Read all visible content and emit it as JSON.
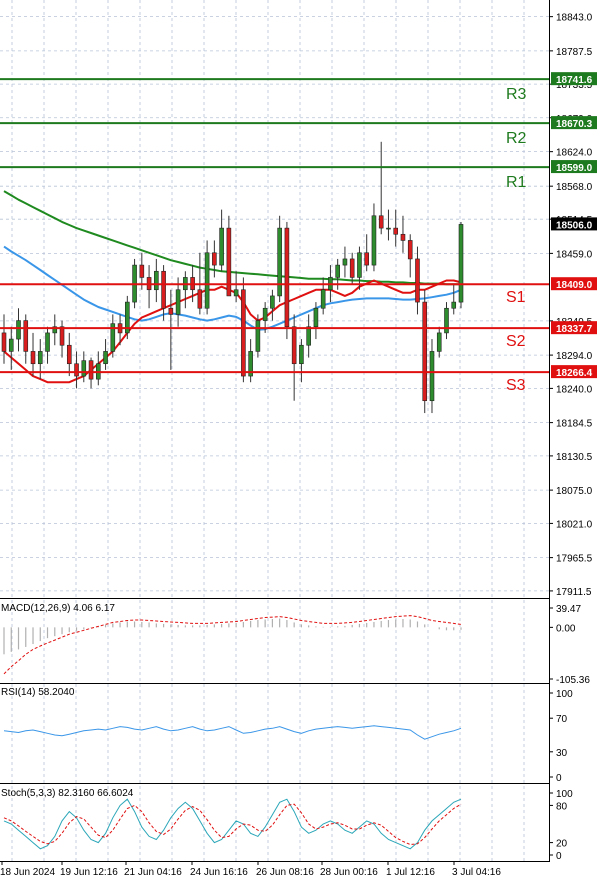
{
  "chart_data": [
    {
      "type": "candlestick",
      "panel": "main",
      "ylim": [
        17900,
        18870
      ],
      "y_ticks": [
        "18843.0",
        "18787.5",
        "18733.5",
        "18679.0",
        "18624.0",
        "18568.0",
        "18514.5",
        "18459.0",
        "18349.5",
        "18294.0",
        "18240.0",
        "18184.5",
        "18130.5",
        "18075.0",
        "18021.0",
        "17965.5",
        "17911.5"
      ],
      "x_labels": [
        "18 Jun 2024",
        "19 Jun 12:16",
        "21 Jun 04:16",
        "24 Jun 16:16",
        "26 Jun 08:16",
        "28 Jun 00:16",
        "1 Jul 12:16",
        "3 Jul 04:16"
      ],
      "current_price": "18506.0",
      "colors": {
        "bull": "#2e8b2e",
        "bear": "#d81e1e",
        "resistance": "#1e7a1e",
        "support": "#e01010",
        "ma_fast": "#e01010",
        "ma_mid": "#3a96e8",
        "ma_slow": "#1f8a1f",
        "grid": "#b8c4d8"
      },
      "levels": [
        {
          "name": "R3",
          "value": 18741.6,
          "label": "18741.6",
          "kind": "resistance"
        },
        {
          "name": "R2",
          "value": 18670.3,
          "label": "18670.3",
          "kind": "resistance"
        },
        {
          "name": "R1",
          "value": 18599.0,
          "label": "18599.0",
          "kind": "resistance"
        },
        {
          "name": "S1",
          "value": 18409.0,
          "label": "18409.0",
          "kind": "support"
        },
        {
          "name": "S2",
          "value": 18337.7,
          "label": "18337.7",
          "kind": "support"
        },
        {
          "name": "S3",
          "value": 18266.4,
          "label": "18266.4",
          "kind": "support"
        }
      ],
      "candles": [
        [
          18330,
          18360,
          18280,
          18300
        ],
        [
          18300,
          18340,
          18270,
          18320
        ],
        [
          18320,
          18370,
          18300,
          18350
        ],
        [
          18350,
          18360,
          18280,
          18300
        ],
        [
          18300,
          18330,
          18260,
          18280
        ],
        [
          18280,
          18320,
          18255,
          18300
        ],
        [
          18300,
          18340,
          18280,
          18330
        ],
        [
          18330,
          18360,
          18310,
          18340
        ],
        [
          18340,
          18350,
          18290,
          18310
        ],
        [
          18310,
          18330,
          18260,
          18280
        ],
        [
          18280,
          18300,
          18240,
          18260
        ],
        [
          18260,
          18300,
          18250,
          18285
        ],
        [
          18285,
          18290,
          18240,
          18255
        ],
        [
          18255,
          18300,
          18245,
          18280
        ],
        [
          18280,
          18320,
          18270,
          18300
        ],
        [
          18300,
          18360,
          18290,
          18345
        ],
        [
          18345,
          18360,
          18310,
          18330
        ],
        [
          18330,
          18390,
          18320,
          18380
        ],
        [
          18380,
          18450,
          18370,
          18440
        ],
        [
          18440,
          18460,
          18400,
          18420
        ],
        [
          18420,
          18440,
          18370,
          18400
        ],
        [
          18400,
          18450,
          18380,
          18430
        ],
        [
          18430,
          18440,
          18350,
          18370
        ],
        [
          18370,
          18400,
          18270,
          18360
        ],
        [
          18360,
          18420,
          18340,
          18400
        ],
        [
          18400,
          18430,
          18370,
          18420
        ],
        [
          18420,
          18440,
          18380,
          18400
        ],
        [
          18400,
          18460,
          18360,
          18370
        ],
        [
          18370,
          18480,
          18360,
          18460
        ],
        [
          18460,
          18480,
          18420,
          18440
        ],
        [
          18440,
          18530,
          18430,
          18500
        ],
        [
          18500,
          18520,
          18460,
          18390
        ],
        [
          18390,
          18430,
          18380,
          18400
        ],
        [
          18400,
          18420,
          18250,
          18260
        ],
        [
          18260,
          18320,
          18250,
          18300
        ],
        [
          18300,
          18360,
          18290,
          18350
        ],
        [
          18350,
          18380,
          18330,
          18370
        ],
        [
          18370,
          18400,
          18350,
          18390
        ],
        [
          18390,
          18520,
          18380,
          18500
        ],
        [
          18500,
          18510,
          18320,
          18340
        ],
        [
          18340,
          18360,
          18220,
          18280
        ],
        [
          18280,
          18320,
          18250,
          18310
        ],
        [
          18310,
          18360,
          18290,
          18340
        ],
        [
          18340,
          18380,
          18320,
          18370
        ],
        [
          18370,
          18420,
          18360,
          18400
        ],
        [
          18400,
          18440,
          18380,
          18420
        ],
        [
          18420,
          18450,
          18400,
          18440
        ],
        [
          18440,
          18470,
          18420,
          18450
        ],
        [
          18450,
          18460,
          18410,
          18420
        ],
        [
          18420,
          18470,
          18400,
          18460
        ],
        [
          18460,
          18490,
          18430,
          18440
        ],
        [
          18440,
          18540,
          18430,
          18520
        ],
        [
          18520,
          18640,
          18490,
          18500
        ],
        [
          18500,
          18530,
          18480,
          18500
        ],
        [
          18500,
          18530,
          18470,
          18490
        ],
        [
          18490,
          18520,
          18460,
          18480
        ],
        [
          18480,
          18490,
          18420,
          18450
        ],
        [
          18450,
          18470,
          18360,
          18380
        ],
        [
          18380,
          18400,
          18200,
          18220
        ],
        [
          18220,
          18320,
          18200,
          18300
        ],
        [
          18300,
          18340,
          18290,
          18330
        ],
        [
          18330,
          18380,
          18320,
          18370
        ],
        [
          18370,
          18410,
          18360,
          18380
        ],
        [
          18380,
          18510,
          18370,
          18506
        ]
      ],
      "ma_fast": [
        18300,
        18290,
        18280,
        18270,
        18260,
        18255,
        18250,
        18250,
        18250,
        18250,
        18255,
        18260,
        18270,
        18280,
        18290,
        18300,
        18315,
        18330,
        18345,
        18355,
        18360,
        18365,
        18370,
        18375,
        18380,
        18385,
        18390,
        18395,
        18400,
        18400,
        18405,
        18400,
        18395,
        18380,
        18360,
        18350,
        18355,
        18365,
        18375,
        18380,
        18385,
        18390,
        18395,
        18400,
        18400,
        18400,
        18395,
        18390,
        18395,
        18405,
        18410,
        18415,
        18410,
        18405,
        18400,
        18395,
        18395,
        18400,
        18400,
        18405,
        18410,
        18415,
        18415,
        18412
      ],
      "ma_mid": [
        18470,
        18462,
        18455,
        18448,
        18440,
        18432,
        18424,
        18416,
        18408,
        18400,
        18392,
        18384,
        18378,
        18372,
        18368,
        18364,
        18360,
        18356,
        18352,
        18350,
        18352,
        18356,
        18360,
        18362,
        18360,
        18358,
        18355,
        18352,
        18350,
        18352,
        18355,
        18358,
        18356,
        18350,
        18342,
        18335,
        18336,
        18340,
        18345,
        18350,
        18355,
        18360,
        18365,
        18370,
        18375,
        18378,
        18380,
        18382,
        18384,
        18385,
        18386,
        18386,
        18386,
        18386,
        18385,
        18384,
        18384,
        18385,
        18386,
        18388,
        18390,
        18392,
        18395,
        18400
      ],
      "ma_slow": [
        18560,
        18553,
        18546,
        18540,
        18534,
        18528,
        18522,
        18516,
        18510,
        18505,
        18500,
        18496,
        18492,
        18488,
        18484,
        18480,
        18476,
        18472,
        18468,
        18464,
        18460,
        18456,
        18452,
        18448,
        18445,
        18442,
        18439,
        18436,
        18434,
        18432,
        18430,
        18429,
        18428,
        18427,
        18426,
        18425,
        18424,
        18423,
        18422,
        18421,
        18420,
        18419,
        18418,
        18418,
        18418,
        18417,
        18417,
        18416,
        18415,
        18415,
        18414,
        18414,
        18413,
        18413,
        18412,
        18412,
        18411,
        18411,
        18410,
        18410,
        18410,
        18409,
        18409,
        18409
      ]
    },
    {
      "type": "histogram",
      "panel": "macd",
      "label": "MACD(12,26,9) 4.06 6.17",
      "ylim": [
        -105.36,
        39.47
      ],
      "y_ticks": [
        "39.47",
        "0.00",
        "-105.36"
      ],
      "signal": [
        -95,
        -80,
        -68,
        -55,
        -45,
        -38,
        -32,
        -26,
        -20,
        -14,
        -10,
        -6,
        -2,
        2,
        6,
        10,
        12,
        14,
        15,
        15,
        14,
        13,
        12,
        11,
        10,
        9,
        8,
        8,
        8,
        9,
        10,
        11,
        12,
        14,
        16,
        18,
        20,
        21,
        22,
        20,
        17,
        14,
        12,
        10,
        8,
        8,
        8,
        9,
        10,
        12,
        14,
        16,
        18,
        20,
        22,
        23,
        24,
        22,
        18,
        14,
        12,
        10,
        8,
        6
      ],
      "hist": [
        -55,
        -50,
        -45,
        -40,
        -34,
        -28,
        -22,
        -18,
        -14,
        -10,
        -7,
        -4,
        -1,
        2,
        5,
        8,
        10,
        12,
        12,
        11,
        10,
        8,
        7,
        6,
        5,
        4,
        4,
        4,
        5,
        6,
        7,
        8,
        9,
        11,
        13,
        15,
        16,
        17,
        18,
        15,
        10,
        6,
        4,
        2,
        1,
        1,
        2,
        3,
        5,
        7,
        9,
        11,
        13,
        15,
        16,
        17,
        16,
        12,
        6,
        0,
        -4,
        -6,
        -6,
        -5
      ]
    },
    {
      "type": "line",
      "panel": "rsi",
      "label": "RSI(14) 58.2040",
      "ylim": [
        0,
        100
      ],
      "y_ticks": [
        "100",
        "70",
        "30",
        "0"
      ],
      "values": [
        55,
        54,
        53,
        55,
        56,
        54,
        52,
        50,
        49,
        51,
        53,
        55,
        56,
        57,
        56,
        58,
        60,
        59,
        57,
        56,
        58,
        60,
        57,
        55,
        56,
        58,
        60,
        57,
        55,
        56,
        58,
        60,
        56,
        52,
        53,
        55,
        57,
        58,
        60,
        57,
        54,
        52,
        55,
        57,
        58,
        59,
        60,
        59,
        58,
        59,
        60,
        61,
        60,
        59,
        58,
        57,
        56,
        50,
        45,
        48,
        51,
        53,
        55,
        58
      ]
    },
    {
      "type": "line",
      "panel": "stoch",
      "label": "Stoch(5,3,3) 82.3160 66.6024",
      "ylim": [
        0,
        100
      ],
      "y_ticks": [
        "100",
        "80",
        "20",
        "0"
      ],
      "k": [
        55,
        50,
        40,
        30,
        20,
        10,
        15,
        30,
        55,
        70,
        60,
        40,
        25,
        20,
        35,
        60,
        80,
        90,
        70,
        45,
        30,
        25,
        40,
        60,
        75,
        85,
        75,
        55,
        35,
        20,
        25,
        40,
        55,
        50,
        35,
        30,
        45,
        65,
        85,
        90,
        70,
        45,
        35,
        40,
        50,
        55,
        50,
        40,
        35,
        45,
        55,
        50,
        35,
        25,
        20,
        15,
        10,
        20,
        40,
        55,
        65,
        75,
        85,
        90
      ],
      "d": [
        60,
        55,
        47,
        38,
        30,
        22,
        18,
        22,
        35,
        52,
        62,
        58,
        45,
        32,
        28,
        40,
        58,
        75,
        80,
        70,
        52,
        38,
        33,
        42,
        58,
        72,
        78,
        72,
        57,
        40,
        28,
        30,
        42,
        50,
        48,
        40,
        38,
        48,
        65,
        80,
        82,
        68,
        50,
        42,
        45,
        50,
        52,
        48,
        42,
        42,
        48,
        52,
        48,
        38,
        28,
        22,
        17,
        18,
        28,
        42,
        55,
        65,
        75,
        82
      ]
    }
  ]
}
